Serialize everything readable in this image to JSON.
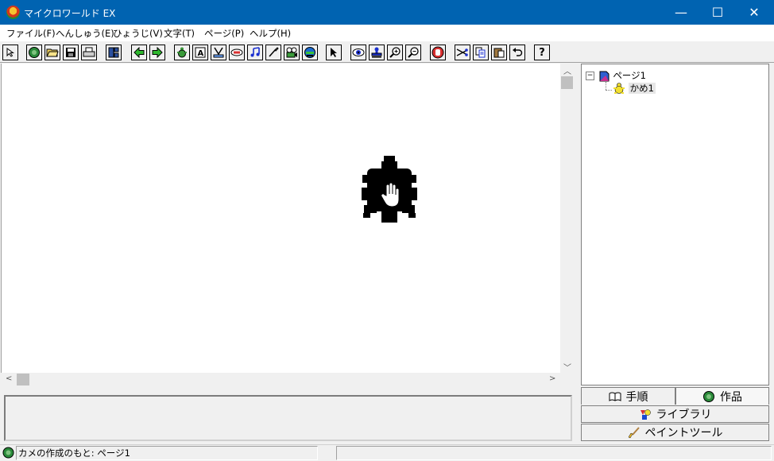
{
  "window": {
    "title": "マイクロワールド EX",
    "minimize": "—",
    "maximize": "☐",
    "close": "✕"
  },
  "menu": [
    "ファイル(F)",
    "へんしゅう(E)",
    "ひょうじ(V)",
    "文字(T)",
    "ページ(P)",
    "ヘルプ(H)"
  ],
  "toolbar": {
    "icons": [
      "pointer-arrow-icon",
      "new-project-icon",
      "open-folder-icon",
      "save-disk-icon",
      "print-icon",
      "page-sorter-icon",
      "back-arrow-icon",
      "forward-arrow-icon",
      "new-turtle-icon",
      "text-box-icon",
      "button-tool-icon",
      "slider-icon",
      "music-icon",
      "paint-brush-icon",
      "video-icon",
      "globe-icon",
      "select-icon",
      "eye-icon",
      "stamp-icon",
      "zoom-in-icon",
      "zoom-out-icon",
      "stop-hand-icon",
      "cut-icon",
      "copy-icon",
      "paste-icon",
      "undo-icon",
      "help-icon"
    ]
  },
  "tree": {
    "page": "ページ1",
    "turtle": "かめ1"
  },
  "tabs": {
    "procedures": "手順",
    "project": "作品",
    "library": "ライブラリ",
    "paint_tools": "ペイントツール"
  },
  "status": {
    "text": "カメの作成のもと: ページ1"
  },
  "colors": {
    "titlebar": "#0063b1",
    "canvas": "#ffffff",
    "turtle": "#000000"
  }
}
